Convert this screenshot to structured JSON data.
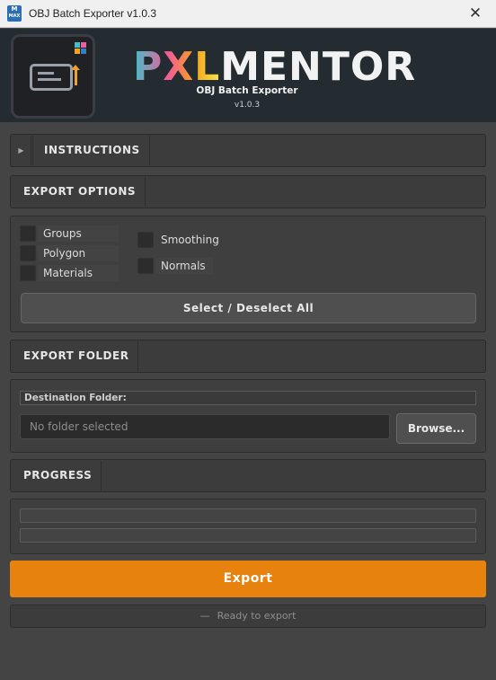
{
  "window": {
    "title": "OBJ Batch Exporter v1.0.3",
    "icon_letters": "M",
    "icon_sub": "MAX",
    "close_glyph": "✕"
  },
  "banner": {
    "brand_part1": "PXL",
    "brand_part2": "MENTOR",
    "subtitle": "OBJ Batch Exporter",
    "version": "v1.0.3",
    "accent_color": "#e8820e"
  },
  "instructions": {
    "label": "INSTRUCTIONS",
    "toggle_glyph": "▶",
    "expanded": false
  },
  "export_options": {
    "label": "EXPORT OPTIONS",
    "options_left": [
      {
        "label": "Groups",
        "checked": false
      },
      {
        "label": "Polygon Groups",
        "checked": false
      },
      {
        "label": "Materials",
        "checked": false
      }
    ],
    "options_right": [
      {
        "label": "Smoothing",
        "checked": false
      },
      {
        "label": "Normals",
        "checked": false
      }
    ],
    "select_all_label": "Select / Deselect All"
  },
  "export_folder": {
    "label": "EXPORT FOLDER",
    "destination_label": "Destination Folder:",
    "folder_placeholder": "No folder selected",
    "browse_label": "Browse..."
  },
  "progress": {
    "label": "PROGRESS",
    "bar1_fraction": 0,
    "bar2_fraction": 0
  },
  "export_label": "Export",
  "status": {
    "dash": "—",
    "text": "Ready to export"
  }
}
